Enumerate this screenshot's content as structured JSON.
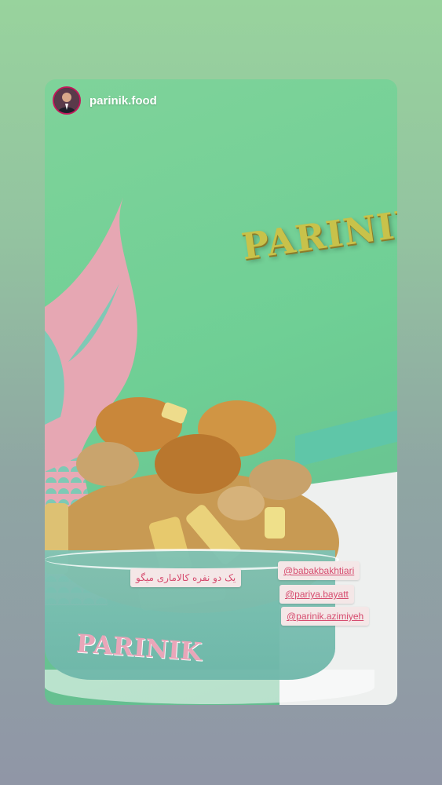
{
  "story": {
    "username": "parinik.food",
    "background_text": "PARINIK",
    "bowl_brand": "PARINIK"
  },
  "caption": "یک دو نفره کالاماری میگو",
  "mentions": [
    "@babakbakhtiari",
    "@pariya.bayatt",
    "@parinik.azimiyeh"
  ],
  "colors": {
    "accent": "#c2185b",
    "sticker_bg": "#f4e7e7",
    "sticker_text": "#d64b6e"
  }
}
